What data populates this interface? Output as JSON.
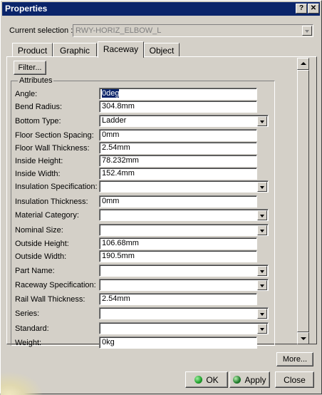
{
  "window": {
    "title": "Properties",
    "help_btn": "?",
    "close_btn": "✕"
  },
  "selection": {
    "label": "Current selection :",
    "value": "RWY-HORIZ_ELBOW_L"
  },
  "tabs": [
    {
      "label": "Product"
    },
    {
      "label": "Graphic"
    },
    {
      "label": "Raceway",
      "active": true
    },
    {
      "label": "Object"
    }
  ],
  "filter_button": "Filter...",
  "attributes": {
    "legend": "Attributes",
    "rows": [
      {
        "label": "Angle:",
        "value": "0deg",
        "type": "text"
      },
      {
        "label": "Bend Radius:",
        "value": "304.8mm",
        "type": "text"
      },
      {
        "label": "Bottom Type:",
        "value": "Ladder",
        "type": "combo"
      },
      {
        "label": "Floor Section Spacing:",
        "value": "0mm",
        "type": "text"
      },
      {
        "label": "Floor Wall Thickness:",
        "value": "2.54mm",
        "type": "text"
      },
      {
        "label": "Inside Height:",
        "value": "78.232mm",
        "type": "text"
      },
      {
        "label": "Inside Width:",
        "value": "152.4mm",
        "type": "text"
      },
      {
        "label": "Insulation Specification:",
        "value": "",
        "type": "combo"
      },
      {
        "label": "Insulation Thickness:",
        "value": "0mm",
        "type": "text"
      },
      {
        "label": "Material Category:",
        "value": "",
        "type": "combo"
      },
      {
        "label": "Nominal Size:",
        "value": "",
        "type": "combo"
      },
      {
        "label": "Outside Height:",
        "value": "106.68mm",
        "type": "text"
      },
      {
        "label": "Outside Width:",
        "value": "190.5mm",
        "type": "text"
      },
      {
        "label": "Part Name:",
        "value": "",
        "type": "combo"
      },
      {
        "label": "Raceway Specification:",
        "value": "",
        "type": "combo"
      },
      {
        "label": "Rail Wall Thickness:",
        "value": "2.54mm",
        "type": "text"
      },
      {
        "label": "Series:",
        "value": "",
        "type": "combo"
      },
      {
        "label": "Standard:",
        "value": "",
        "type": "combo"
      },
      {
        "label": "Weight:",
        "value": "0kg",
        "type": "text"
      }
    ]
  },
  "buttons": {
    "more": "More...",
    "ok": "OK",
    "apply": "Apply",
    "close": "Close"
  },
  "colors": {
    "titlebar": "#0a246a",
    "ok_icon": "#1e9e2a",
    "apply_icon": "#1e7a2a"
  }
}
